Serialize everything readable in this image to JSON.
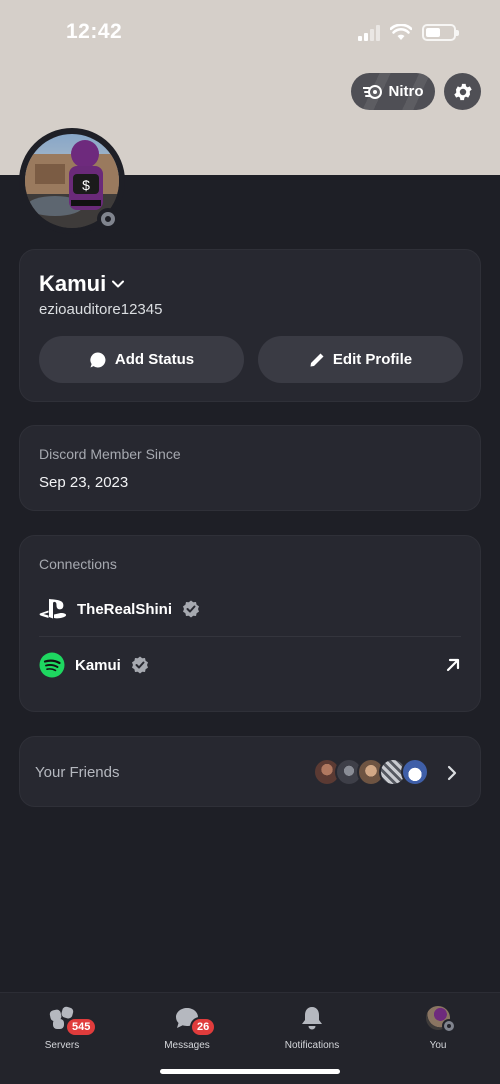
{
  "status_bar": {
    "time": "12:42"
  },
  "header": {
    "nitro_label": "Nitro"
  },
  "profile": {
    "display_name": "Kamui",
    "username": "ezioauditore12345",
    "add_status_label": "Add Status",
    "edit_profile_label": "Edit Profile"
  },
  "member_since": {
    "label": "Discord Member Since",
    "date": "Sep 23, 2023"
  },
  "connections": {
    "label": "Connections",
    "items": [
      {
        "name": "TheRealShini",
        "service": "playstation-icon"
      },
      {
        "name": "Kamui",
        "service": "spotify-icon"
      }
    ]
  },
  "friends": {
    "label": "Your Friends",
    "avatar_colors": [
      "#5b3a33",
      "#3e3f48",
      "#b08a6f",
      "#888b8f",
      "#3f5fa8"
    ]
  },
  "tabs": [
    {
      "label": "Servers",
      "badge": "545"
    },
    {
      "label": "Messages",
      "badge": "26"
    },
    {
      "label": "Notifications",
      "badge": ""
    },
    {
      "label": "You",
      "badge": ""
    }
  ],
  "colors": {
    "background": "#1e1f26",
    "banner": "#d5cfc9",
    "card": "#272830",
    "badge": "#e03c3c",
    "spotify": "#1ed760"
  }
}
